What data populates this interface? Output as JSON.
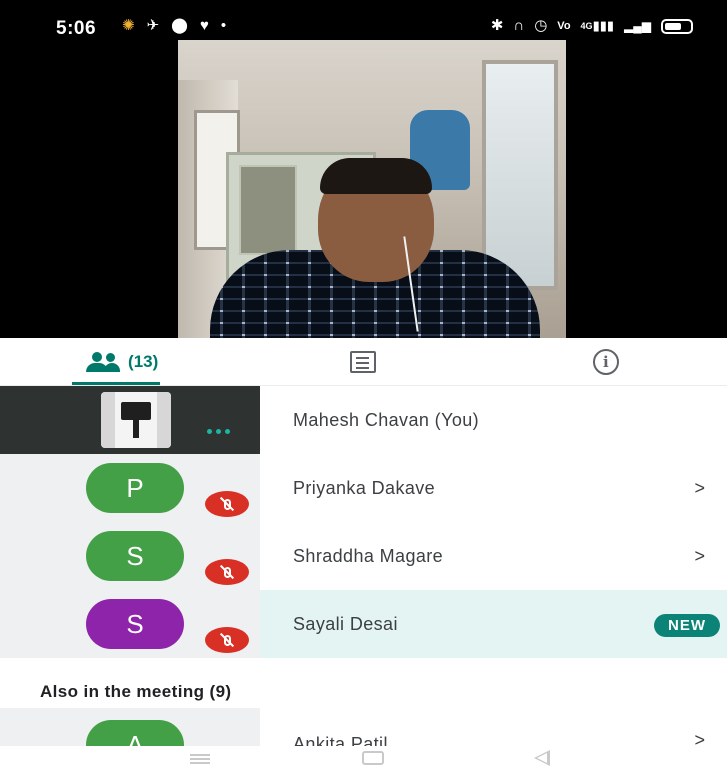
{
  "status_bar": {
    "time": "5:06",
    "left_icons": [
      "notification-icon",
      "app-icon",
      "location-icon",
      "health-icon",
      "dot-icon"
    ],
    "right_icons": [
      "bluetooth-icon",
      "headphones-icon",
      "alarm-icon",
      "volte-icon",
      "wifi-signal-icon",
      "cell-signal-icon",
      "battery-icon"
    ],
    "volte_text": "Vo",
    "network_text": "4G"
  },
  "tabs": {
    "people_count": "(13)",
    "people_icon": "people-icon",
    "chat_icon": "chat-icon",
    "info_icon": "info-icon",
    "info_glyph": "i",
    "active_color": "#00796b"
  },
  "participants": [
    {
      "name": "Mahesh Chavan (You)",
      "initial": "",
      "avatar_color": "",
      "muted": false,
      "is_you": true,
      "speaking": true,
      "chevron": ""
    },
    {
      "name": "Priyanka Dakave",
      "initial": "P",
      "avatar_color": "#43a047",
      "muted": true,
      "chevron": ">"
    },
    {
      "name": "Shraddha Magare",
      "initial": "S",
      "avatar_color": "#43a047",
      "muted": true,
      "chevron": ">"
    },
    {
      "name": "Sayali Desai",
      "initial": "S",
      "avatar_color": "#8e24aa",
      "muted": true,
      "badge": "NEW",
      "chevron": ""
    }
  ],
  "also_in_meeting": {
    "title": "Also in the meeting (9)",
    "first_partial": {
      "name": "Ankita Patil",
      "initial": "A",
      "avatar_color": "#43a047",
      "chevron": ">"
    }
  },
  "colors": {
    "badge_new": "#0b8477",
    "muted_badge": "#d93025",
    "highlight_row": "#e4f4f3"
  },
  "nav_bar": {
    "icons": [
      "menu-icon",
      "home-icon",
      "back-icon"
    ]
  }
}
